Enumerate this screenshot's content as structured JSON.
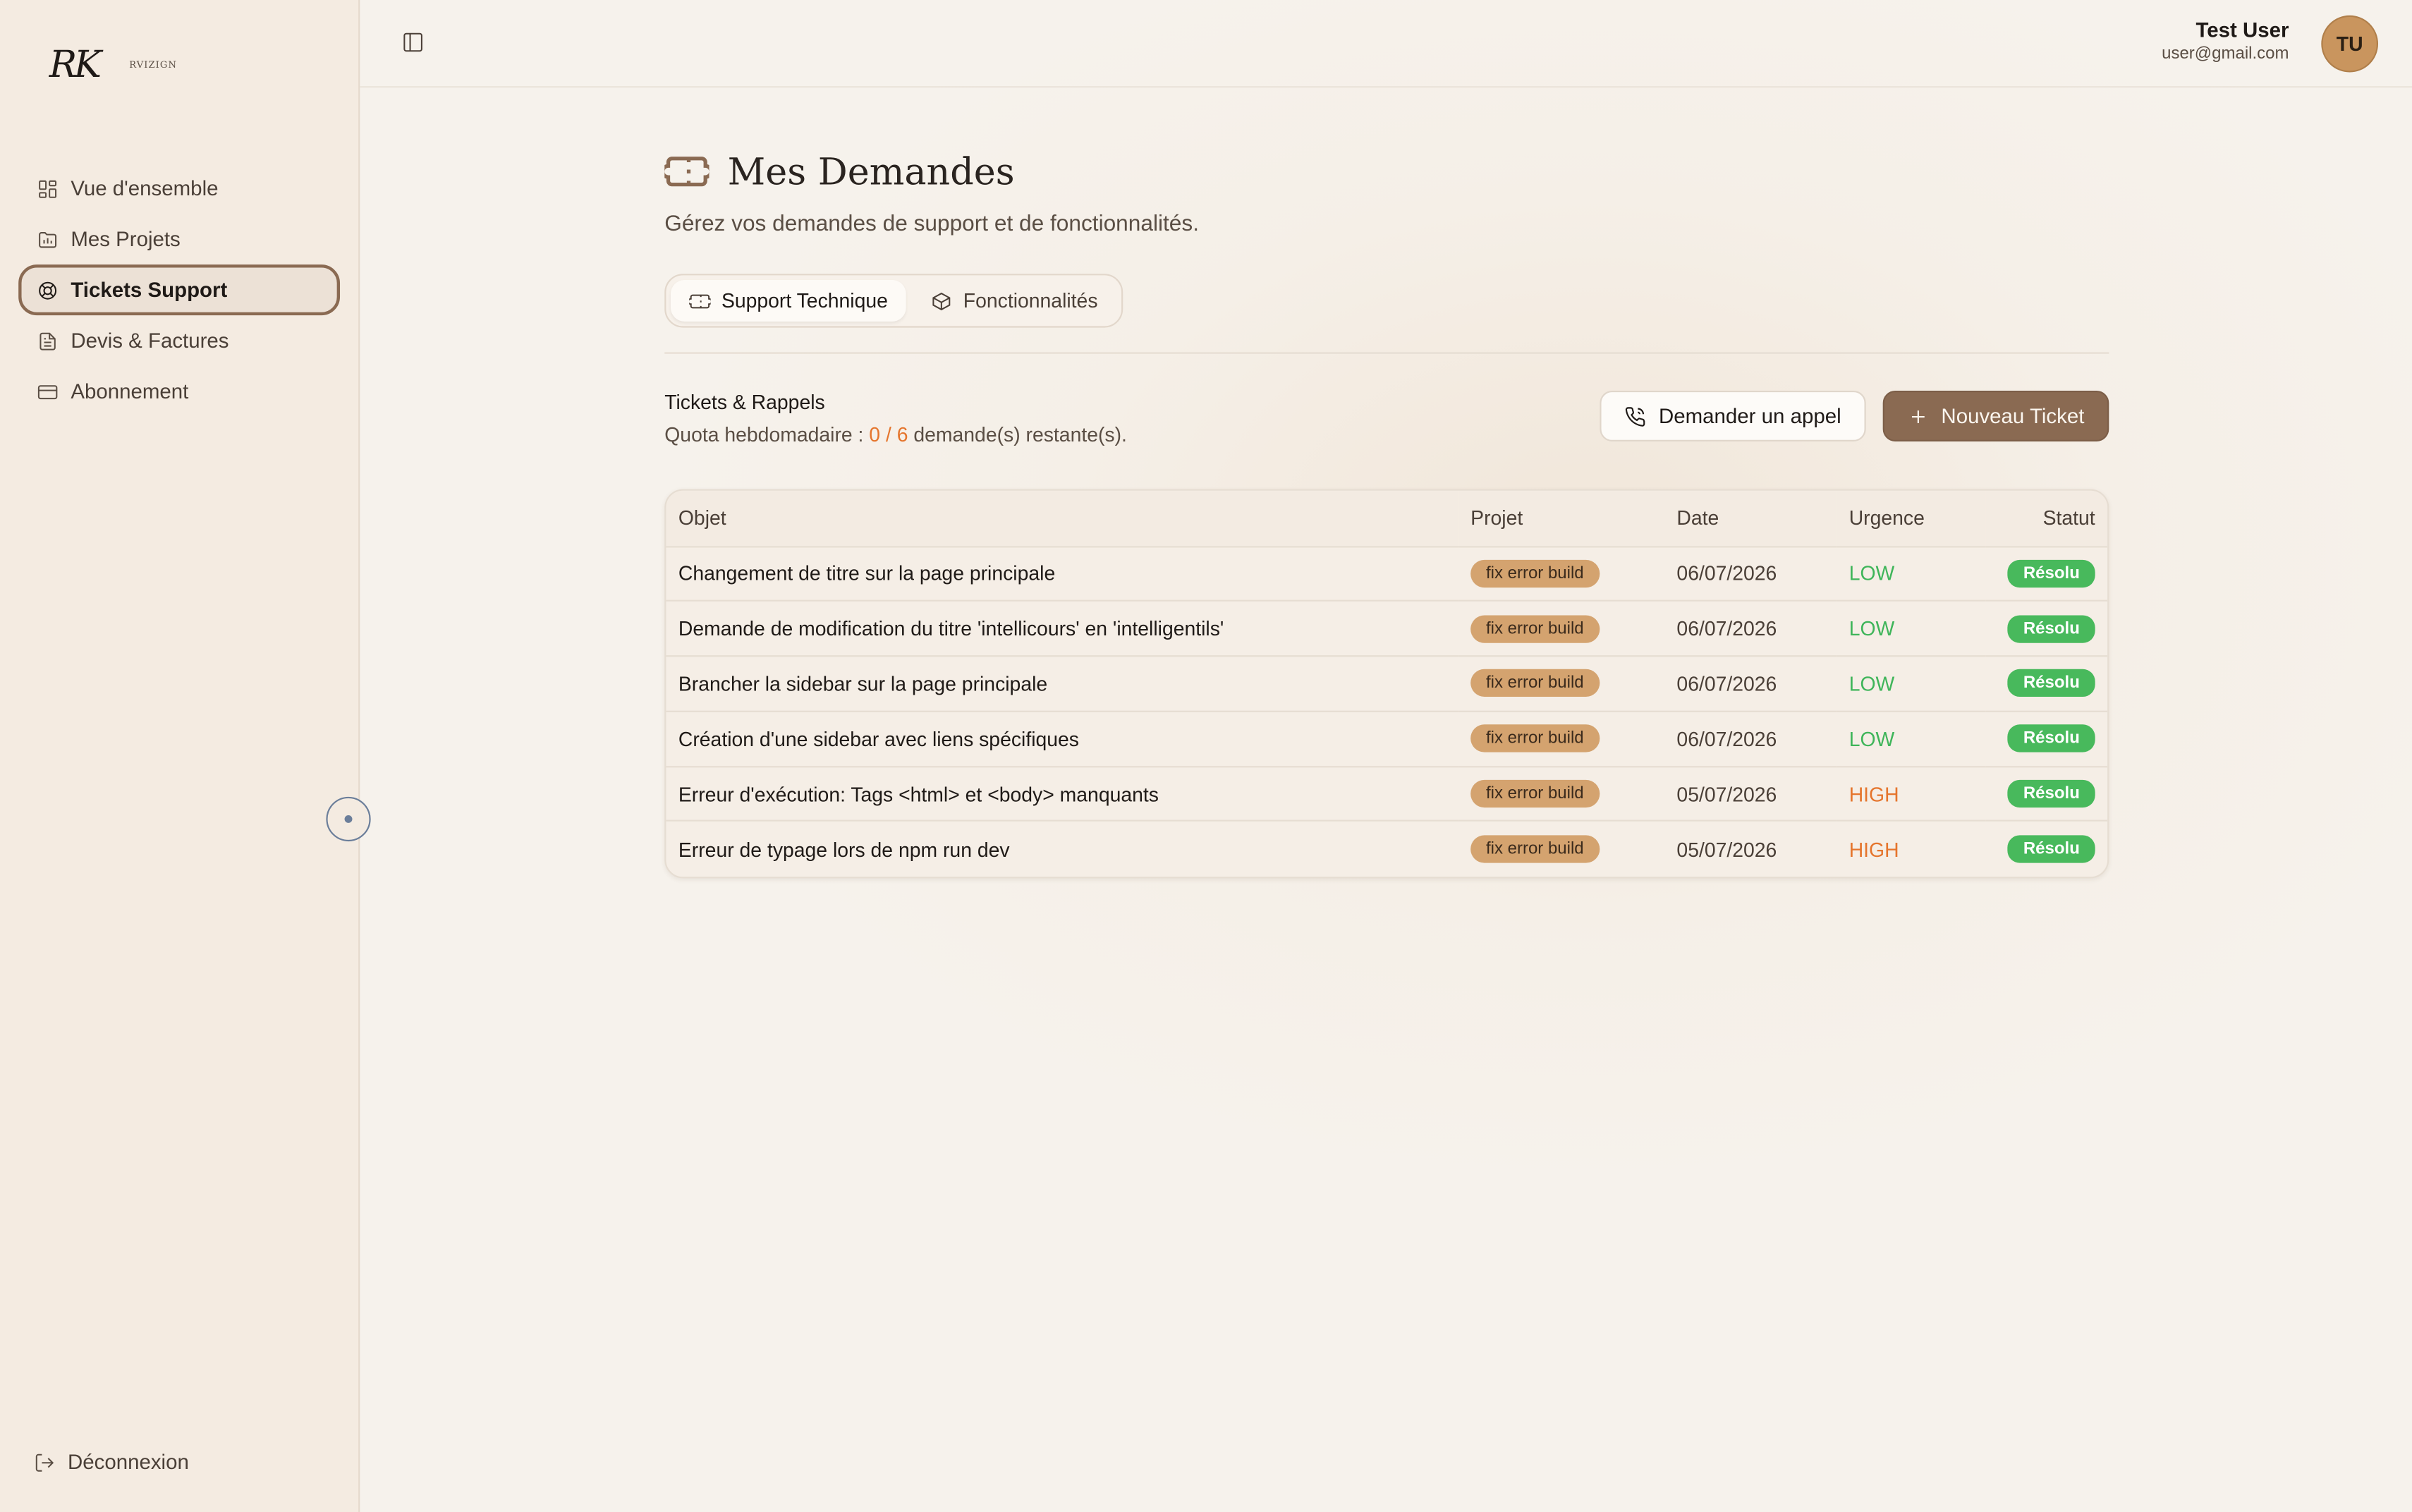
{
  "brand": {
    "mark": "RK",
    "wordmark": "RVIZIGN"
  },
  "sidebar": {
    "items": [
      {
        "label": "Vue d'ensemble",
        "icon": "grid-icon"
      },
      {
        "label": "Mes Projets",
        "icon": "folder-icon"
      },
      {
        "label": "Tickets Support",
        "icon": "lifebuoy-icon",
        "active": true
      },
      {
        "label": "Devis & Factures",
        "icon": "document-icon"
      },
      {
        "label": "Abonnement",
        "icon": "credit-card-icon"
      }
    ],
    "logout": "Déconnexion"
  },
  "header": {
    "user_name": "Test User",
    "user_email": "user@gmail.com",
    "avatar_initials": "TU"
  },
  "page": {
    "title": "Mes Demandes",
    "subtitle": "Gérez vos demandes de support et de fonctionnalités.",
    "tabs": [
      {
        "label": "Support Technique",
        "icon": "ticket-icon",
        "active": true
      },
      {
        "label": "Fonctionnalités",
        "icon": "box-icon"
      }
    ]
  },
  "tickets": {
    "section_title": "Tickets & Rappels",
    "quota_prefix": "Quota hebdomadaire : ",
    "quota_value": "0 / 6",
    "quota_suffix": " demande(s) restante(s).",
    "call_button": "Demander un appel",
    "new_button": "Nouveau Ticket",
    "columns": {
      "objet": "Objet",
      "projet": "Projet",
      "date": "Date",
      "urgence": "Urgence",
      "statut": "Statut"
    },
    "rows": [
      {
        "objet": "Changement de titre sur la page principale",
        "projet": "fix error build",
        "date": "06/07/2026",
        "urgence": "LOW",
        "statut": "Résolu"
      },
      {
        "objet": "Demande de modification du titre 'intellicours' en 'intelligentils'",
        "projet": "fix error build",
        "date": "06/07/2026",
        "urgence": "LOW",
        "statut": "Résolu"
      },
      {
        "objet": "Brancher la sidebar sur la page principale",
        "projet": "fix error build",
        "date": "06/07/2026",
        "urgence": "LOW",
        "statut": "Résolu"
      },
      {
        "objet": "Création d'une sidebar avec liens spécifiques",
        "projet": "fix error build",
        "date": "06/07/2026",
        "urgence": "LOW",
        "statut": "Résolu"
      },
      {
        "objet": "Erreur d'exécution: Tags <html> et <body> manquants",
        "projet": "fix error build",
        "date": "05/07/2026",
        "urgence": "HIGH",
        "statut": "Résolu"
      },
      {
        "objet": "Erreur de typage lors de npm run dev",
        "projet": "fix error build",
        "date": "05/07/2026",
        "urgence": "HIGH",
        "statut": "Résolu"
      }
    ]
  },
  "colors": {
    "accent": "#8a6a52",
    "low": "#3fb55a",
    "high": "#e5752d",
    "resolved": "#48b95c",
    "project_badge": "#d4a36f"
  }
}
